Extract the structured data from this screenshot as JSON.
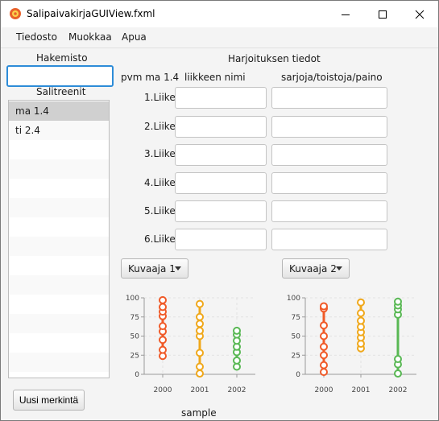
{
  "window": {
    "title": "SalipaivakirjaGUIView.fxml",
    "controls": [
      "minimize-icon",
      "maximize-icon",
      "close-icon"
    ]
  },
  "menu": [
    "Tiedosto",
    "Muokkaa",
    "Apua"
  ],
  "left": {
    "directory_label": "Hakemisto",
    "search_value": "",
    "list_label": "Salitreenit",
    "items": [
      {
        "label": "ma 1.4",
        "selected": true
      },
      {
        "label": "ti 2.4",
        "selected": false
      }
    ],
    "new_button": "Uusi merkintä"
  },
  "details": {
    "title": "Harjoituksen tiedot",
    "date": "pvm ma 1.4",
    "col_name": "liikkeen nimi",
    "col_sets": "sarjoja/toistoja/paino",
    "rows": [
      {
        "label": "1.Liike",
        "name": "",
        "sets": ""
      },
      {
        "label": "2.Liike",
        "name": "",
        "sets": ""
      },
      {
        "label": "3.Liike",
        "name": "",
        "sets": ""
      },
      {
        "label": "4.Liike",
        "name": "",
        "sets": ""
      },
      {
        "label": "5.Liike",
        "name": "",
        "sets": ""
      },
      {
        "label": "6.Liike",
        "name": "",
        "sets": ""
      }
    ]
  },
  "charts": {
    "chooser1": "Kuvaaja 1",
    "chooser2": "Kuvaaja 2",
    "xlabel": "sample"
  },
  "chart_data": [
    {
      "type": "scatter",
      "x_categories": [
        "2000",
        "2001",
        "2002"
      ],
      "ylim": [
        0,
        100
      ],
      "yticks": [
        0,
        25,
        50,
        75,
        100
      ],
      "grid": true,
      "xlabel": "sample",
      "series": [
        {
          "x": "2000",
          "color": "#f05a28",
          "values": [
            24,
            32,
            45,
            56,
            63,
            76,
            82,
            88,
            97
          ]
        },
        {
          "x": "2001",
          "color": "#f0a81b",
          "values": [
            1,
            10,
            28,
            50,
            57,
            66,
            75,
            92
          ]
        },
        {
          "x": "2002",
          "color": "#59b854",
          "values": [
            10,
            18,
            29,
            36,
            44,
            52,
            57
          ]
        }
      ]
    },
    {
      "type": "scatter",
      "x_categories": [
        "2000",
        "2001",
        "2002"
      ],
      "ylim": [
        0,
        100
      ],
      "yticks": [
        0,
        25,
        50,
        75,
        100
      ],
      "grid": true,
      "series": [
        {
          "x": "2000",
          "color": "#f05a28",
          "values": [
            3,
            12,
            25,
            36,
            50,
            64,
            86,
            89
          ]
        },
        {
          "x": "2001",
          "color": "#f0a81b",
          "values": [
            34,
            40,
            48,
            55,
            62,
            70,
            80,
            94
          ]
        },
        {
          "x": "2002",
          "color": "#59b854",
          "values": [
            1,
            13,
            20,
            78,
            85,
            90,
            95
          ]
        }
      ]
    }
  ]
}
